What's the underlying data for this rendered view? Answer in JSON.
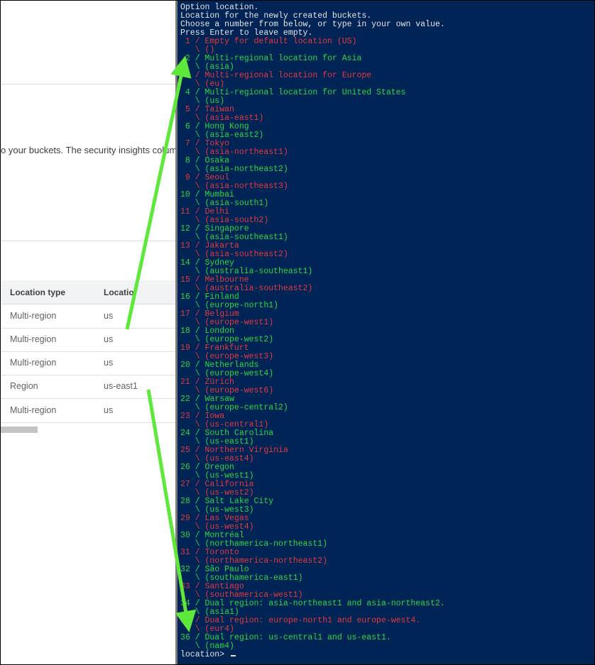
{
  "console": {
    "description_fragment": "o your buckets. The security insights colum",
    "table": {
      "headers": [
        "Location type",
        "Locatio"
      ],
      "rows": [
        [
          "Multi-region",
          "us"
        ],
        [
          "Multi-region",
          "us"
        ],
        [
          "Multi-region",
          "us"
        ],
        [
          "Region",
          "us-east1"
        ],
        [
          "Multi-region",
          "us"
        ]
      ]
    }
  },
  "terminal": {
    "header_lines": [
      "Option location.",
      "Location for the newly created buckets.",
      "Choose a number from below, or type in your own value.",
      "Press Enter to leave empty."
    ],
    "options": [
      {
        "num": " 1",
        "name": "Empty for default location (US)",
        "code": "()",
        "color": "red"
      },
      {
        "num": " 2",
        "name": "Multi-regional location for Asia",
        "code": "(asia)",
        "color": "green"
      },
      {
        "num": " 3",
        "name": "Multi-regional location for Europe",
        "code": "(eu)",
        "color": "red"
      },
      {
        "num": " 4",
        "name": "Multi-regional location for United States",
        "code": "(us)",
        "color": "green"
      },
      {
        "num": " 5",
        "name": "Taiwan",
        "code": "(asia-east1)",
        "color": "red"
      },
      {
        "num": " 6",
        "name": "Hong Kong",
        "code": "(asia-east2)",
        "color": "green"
      },
      {
        "num": " 7",
        "name": "Tokyo",
        "code": "(asia-northeast1)",
        "color": "red"
      },
      {
        "num": " 8",
        "name": "Osaka",
        "code": "(asia-northeast2)",
        "color": "green"
      },
      {
        "num": " 9",
        "name": "Seoul",
        "code": "(asia-northeast3)",
        "color": "red"
      },
      {
        "num": "10",
        "name": "Mumbai",
        "code": "(asia-south1)",
        "color": "green"
      },
      {
        "num": "11",
        "name": "Delhi",
        "code": "(asia-south2)",
        "color": "red"
      },
      {
        "num": "12",
        "name": "Singapore",
        "code": "(asia-southeast1)",
        "color": "green"
      },
      {
        "num": "13",
        "name": "Jakarta",
        "code": "(asia-southeast2)",
        "color": "red"
      },
      {
        "num": "14",
        "name": "Sydney",
        "code": "(australia-southeast1)",
        "color": "green"
      },
      {
        "num": "15",
        "name": "Melbourne",
        "code": "(australia-southeast2)",
        "color": "red"
      },
      {
        "num": "16",
        "name": "Finland",
        "code": "(europe-north1)",
        "color": "green"
      },
      {
        "num": "17",
        "name": "Belgium",
        "code": "(europe-west1)",
        "color": "red"
      },
      {
        "num": "18",
        "name": "London",
        "code": "(europe-west2)",
        "color": "green"
      },
      {
        "num": "19",
        "name": "Frankfurt",
        "code": "(europe-west3)",
        "color": "red"
      },
      {
        "num": "20",
        "name": "Netherlands",
        "code": "(europe-west4)",
        "color": "green"
      },
      {
        "num": "21",
        "name": "Zürich",
        "code": "(europe-west6)",
        "color": "red"
      },
      {
        "num": "22",
        "name": "Warsaw",
        "code": "(europe-central2)",
        "color": "green"
      },
      {
        "num": "23",
        "name": "Iowa",
        "code": "(us-central1)",
        "color": "red"
      },
      {
        "num": "24",
        "name": "South Carolina",
        "code": "(us-east1)",
        "color": "green"
      },
      {
        "num": "25",
        "name": "Northern Virginia",
        "code": "(us-east4)",
        "color": "red"
      },
      {
        "num": "26",
        "name": "Oregon",
        "code": "(us-west1)",
        "color": "green"
      },
      {
        "num": "27",
        "name": "California",
        "code": "(us-west2)",
        "color": "red"
      },
      {
        "num": "28",
        "name": "Salt Lake City",
        "code": "(us-west3)",
        "color": "green"
      },
      {
        "num": "29",
        "name": "Las Vegas",
        "code": "(us-west4)",
        "color": "red"
      },
      {
        "num": "30",
        "name": "Montréal",
        "code": "(northamerica-northeast1)",
        "color": "green"
      },
      {
        "num": "31",
        "name": "Toronto",
        "code": "(northamerica-northeast2)",
        "color": "red"
      },
      {
        "num": "32",
        "name": "São Paulo",
        "code": "(southamerica-east1)",
        "color": "green"
      },
      {
        "num": "33",
        "name": "Santiago",
        "code": "(southamerica-west1)",
        "color": "red"
      },
      {
        "num": "34",
        "name": "Dual region: asia-northeast1 and asia-northeast2.",
        "code": "(asia1)",
        "color": "green"
      },
      {
        "num": "35",
        "name": "Dual region: europe-north1 and europe-west4.",
        "code": "(eur4)",
        "color": "red"
      },
      {
        "num": "36",
        "name": "Dual region: us-central1 and us-east1.",
        "code": "(nam4)",
        "color": "green"
      }
    ],
    "prompt": "location> "
  },
  "colors": {
    "terminal_bg": "#012456",
    "option_red": "#e8383d",
    "option_green": "#2bd93f",
    "arrow": "#5ee83a"
  },
  "icons": [
    "cursor-icon",
    "arrow-annotation"
  ]
}
